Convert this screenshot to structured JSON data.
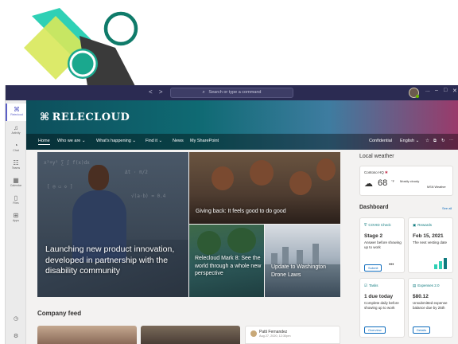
{
  "colors": {
    "accent": "#5b5fc7",
    "header_start": "#0d4f5c",
    "header_end": "#9a3a6a",
    "link": "#0f6cbd",
    "brand_teal": "#2fd0b5"
  },
  "titlebar": {
    "nav_arrows": "< >",
    "search_placeholder": "Search or type a command",
    "search_icon": "search-icon",
    "controls": [
      "...",
      "–",
      "□",
      "✕"
    ]
  },
  "rail": {
    "items": [
      {
        "icon": "activity-icon",
        "label": "Activity"
      },
      {
        "icon": "chat-icon",
        "label": "Chat"
      },
      {
        "icon": "teams-icon",
        "label": "Teams"
      },
      {
        "icon": "calendar-icon",
        "label": "Calendar"
      },
      {
        "icon": "files-icon",
        "label": "Files"
      },
      {
        "icon": "apps-icon",
        "label": "Apps"
      }
    ],
    "active_label": "Relecloud"
  },
  "site": {
    "title": "RELECLOUD",
    "nav": [
      {
        "label": "Home"
      },
      {
        "label": "Who we are",
        "caret": "⌄"
      },
      {
        "label": "What's happening",
        "caret": "⌄"
      },
      {
        "label": "Find it",
        "caret": "⌄"
      },
      {
        "label": "News"
      },
      {
        "label": "My SharePoint"
      }
    ],
    "nav_right": {
      "classification": "Confidential",
      "language": "English"
    }
  },
  "hero": {
    "main": "Launching new product innovation, developed in partnership with the disability community",
    "top_right": "Giving back: It feels good to do good",
    "bottom_left": "Relecloud Mark 8: See the world through a whole new perspective",
    "bottom_right": "Update to Washington Drone Laws"
  },
  "feed": {
    "title": "Company feed",
    "post": {
      "author": "Patti Fernandez",
      "date": "Aug 27, 2020, 12:30pm"
    }
  },
  "weather": {
    "title": "Local weather",
    "location": "Contoso HQ",
    "temp": "68",
    "unit": "°F",
    "condition": "Mostly cloudy",
    "source": "MSN Weather"
  },
  "dashboard": {
    "title": "Dashboard",
    "see_all": "See all",
    "cards": [
      {
        "header": "COVID Check",
        "big": "Stage 2",
        "desc": "Answer before showing up to work",
        "button": "Submit",
        "more": "•••"
      },
      {
        "header": "Rewards",
        "big": "Feb 15, 2021",
        "desc": "The next vesting date"
      },
      {
        "header": "Tasks",
        "big": "1 due today",
        "desc": "Complete daily before showing up to work",
        "button": "Overview"
      },
      {
        "header": "Expenses 2.0",
        "big": "$80.12",
        "desc": "Unsubmitted expense balance due by 25th",
        "button": "Details"
      }
    ]
  }
}
